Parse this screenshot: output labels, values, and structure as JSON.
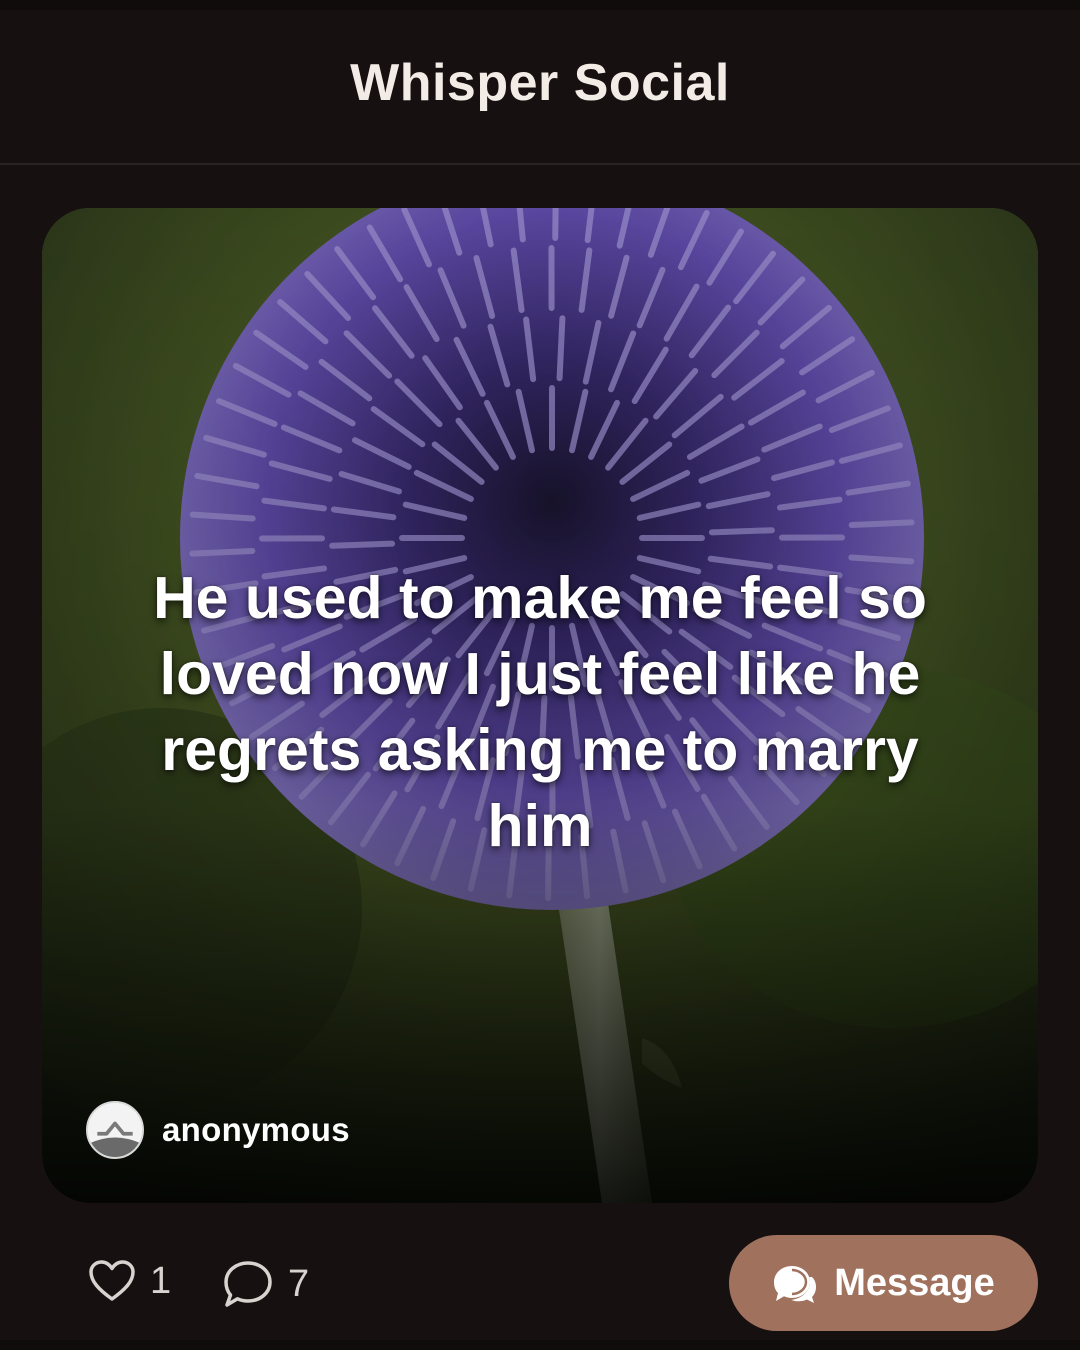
{
  "app": {
    "title": "Whisper Social"
  },
  "post": {
    "text": "He used to make me feel so loved now I just feel like he regrets asking me to marry him",
    "author": "anonymous",
    "background_image": "purple-globe-thistle-flower"
  },
  "actions": {
    "likes": "1",
    "comments": "7",
    "message_label": "Message"
  },
  "colors": {
    "background": "#161110",
    "message_button": "#a0725e",
    "header_text": "#f2ebe6"
  }
}
